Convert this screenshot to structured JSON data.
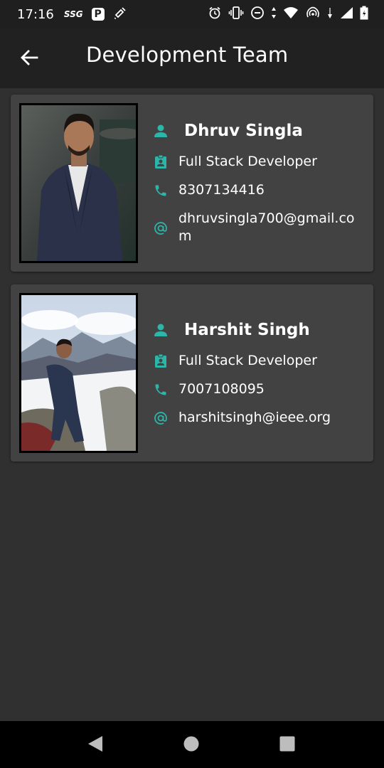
{
  "status_bar": {
    "time": "17:16",
    "tag": "SSG",
    "p_badge": "P",
    "icons": [
      "alarm-icon",
      "vibrate-icon",
      "do-not-disturb-icon",
      "data-arrows-icon",
      "wifi-icon",
      "hotspot-icon",
      "signal-icon",
      "battery-icon"
    ]
  },
  "app_bar": {
    "title": "Development Team",
    "back_icon": "arrow-back-icon"
  },
  "colors": {
    "accent": "#2cb5a8",
    "background": "#303030",
    "card": "#424242",
    "app_bar": "#212121",
    "status_bar": "#1f1f1f"
  },
  "team": [
    {
      "name": "Dhruv Singla",
      "role": "Full Stack Developer",
      "phone": "8307134416",
      "email": "dhruvsingla700@gmail.com"
    },
    {
      "name": "Harshit Singh",
      "role": "Full Stack Developer",
      "phone": "7007108095",
      "email": "harshitsingh@ieee.org"
    }
  ],
  "nav": {
    "back": "nav-back-icon",
    "home": "nav-home-icon",
    "recents": "nav-recents-icon"
  }
}
